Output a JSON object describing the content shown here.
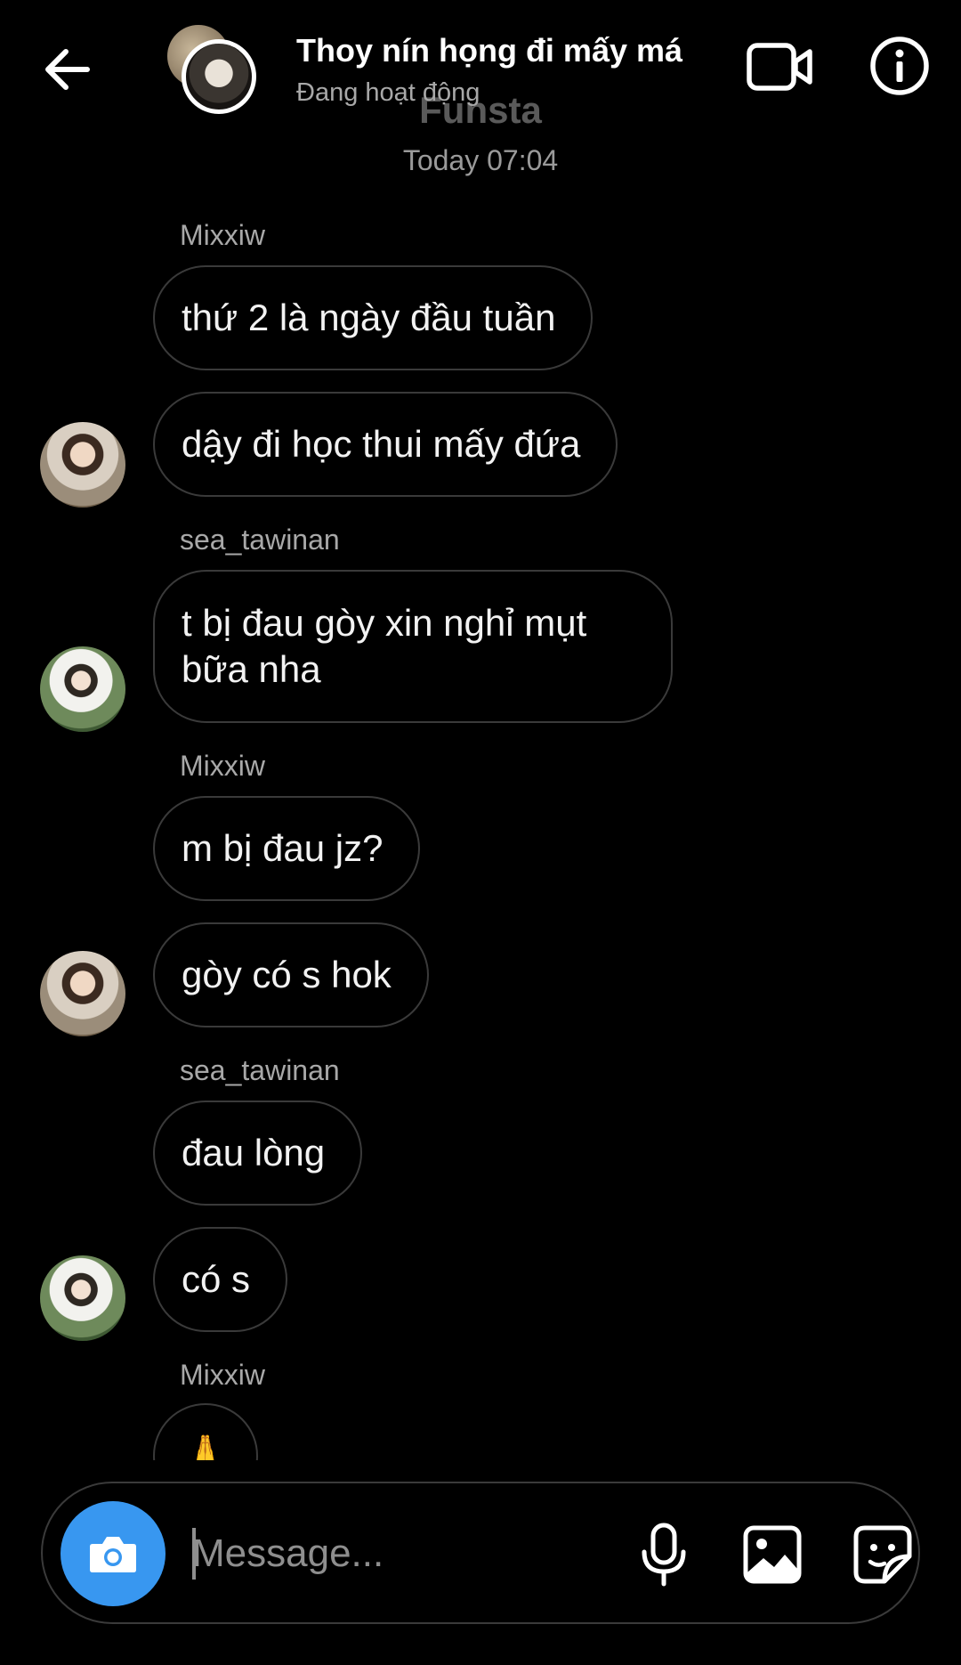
{
  "header": {
    "title": "Thoy nín họng đi mấy má",
    "status": "Đang hoạt động"
  },
  "chat": {
    "watermark": "Funsta",
    "timestamp": "Today 07:04",
    "messages": [
      {
        "sender": "Mixxiw",
        "text": "thứ 2 là ngày đầu tuần"
      },
      {
        "text": "dậy đi học thui mấy đứa"
      },
      {
        "sender": "sea_tawinan",
        "text": "t bị đau gòy xin nghỉ mụt bữa nha"
      },
      {
        "sender": "Mixxiw",
        "text": "m bị đau jz?"
      },
      {
        "text": "gòy có s hok"
      },
      {
        "sender": "sea_tawinan",
        "text": "đau lòng"
      },
      {
        "text": "có s"
      },
      {
        "sender": "Mixxiw",
        "text": "🙏"
      }
    ]
  },
  "composer": {
    "placeholder": "Message..."
  },
  "colors": {
    "background": "#000000",
    "accent": "#3897f0",
    "bubble_border": "#3a3a3a",
    "secondary_text": "#a8a8a8"
  },
  "icons": {
    "back": "arrow-left-icon",
    "video": "video-call-icon",
    "info": "info-icon",
    "camera": "camera-icon",
    "mic": "microphone-icon",
    "gallery": "image-icon",
    "sticker": "sticker-icon"
  }
}
